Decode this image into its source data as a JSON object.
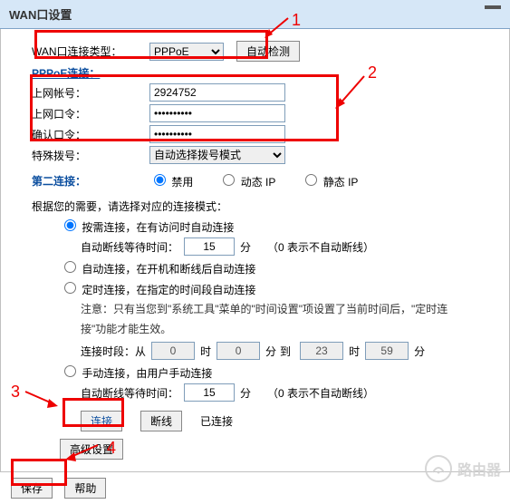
{
  "titlebar": {
    "title": "WAN口设置"
  },
  "wan": {
    "type_label": "WAN口连接类型：",
    "type_value": "PPPoE",
    "auto_detect_label": "自动检测"
  },
  "pppoe": {
    "section": "PPPoE连接：",
    "account_label": "上网帐号：",
    "account_value": "2924752",
    "password_label": "上网口令：",
    "password_value": "••••••••••",
    "confirm_label": "确认口令：",
    "confirm_value": "••••••••••",
    "dialmode_label": "特殊拨号：",
    "dialmode_value": "自动选择拨号模式"
  },
  "second": {
    "section": "第二连接：",
    "opt_disable": "禁用",
    "opt_dynip": "动态 IP",
    "opt_static": "静态 IP"
  },
  "modes": {
    "prompt": "根据您的需要，请选择对应的连接模式：",
    "on_demand": "按需连接，在有访问时自动连接",
    "wait_prefix": "自动断线等待时间：",
    "wait_val1": "15",
    "unit_min": "分",
    "note_zero": "（0 表示不自动断线）",
    "auto": "自动连接，在开机和断线后自动连接",
    "sched": "定时连接，在指定的时间段自动连接",
    "sched_note": "注意：只有当您到\"系统工具\"菜单的\"时间设置\"项设置了当前时间后，\"定时连接\"功能才能生效。",
    "period_label": "连接时段：从",
    "h_from": "0",
    "m_from": "0",
    "to": "到",
    "h_to": "23",
    "m_to": "59",
    "unit_hour": "时",
    "manual": "手动连接，由用户手动连接",
    "wait_val2": "15"
  },
  "buttons": {
    "connect": "连接",
    "disconnect": "断线",
    "status": "已连接",
    "advanced": "高级设置",
    "save": "保存",
    "help": "帮助"
  },
  "annotations": {
    "a1": "1",
    "a2": "2",
    "a3": "3",
    "a4": "4"
  },
  "watermark": {
    "text": "路由器"
  }
}
